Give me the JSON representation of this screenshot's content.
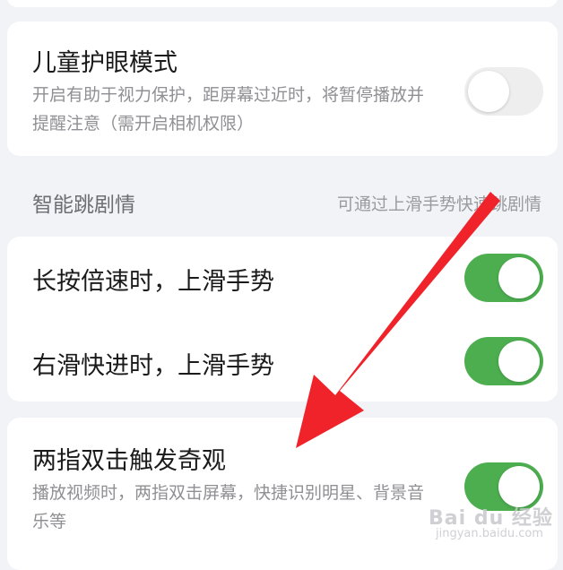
{
  "settings": {
    "child_eye": {
      "title": "儿童护眼模式",
      "desc": "开启有助于视力保护，距屏幕过近时，将暂停播放并提醒注意（需开启相机权限）",
      "enabled": false
    },
    "section": {
      "title": "智能跳剧情",
      "hint": "可通过上滑手势快速跳剧情"
    },
    "long_press": {
      "title": "长按倍速时，上滑手势",
      "enabled": true
    },
    "swipe_forward": {
      "title": "右滑快进时，上滑手势",
      "enabled": true
    },
    "double_tap": {
      "title": "两指双击触发奇观",
      "desc": "播放视频时，两指双击屏幕，快捷识别明星、背景音乐等",
      "enabled": true
    }
  },
  "watermark": {
    "logo": "Bai du 经验",
    "url": "jingyan.baidu.com"
  },
  "colors": {
    "toggle_on": "#4cae4f",
    "toggle_off": "#eeeeef",
    "arrow": "#f0232a"
  }
}
